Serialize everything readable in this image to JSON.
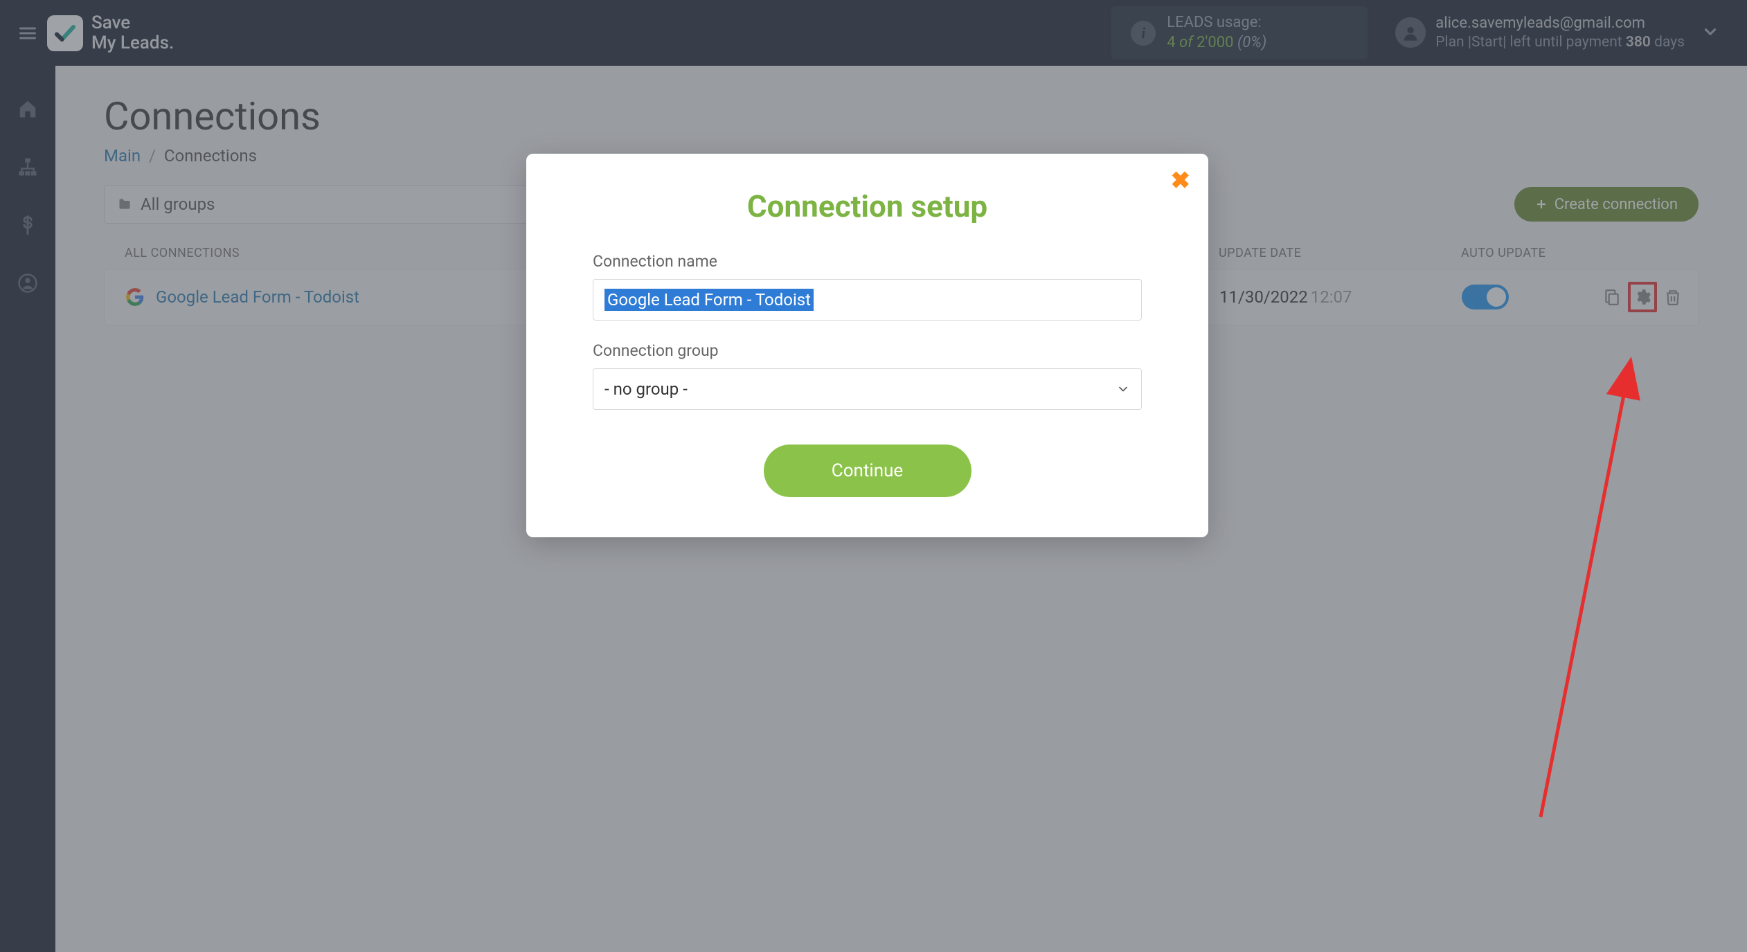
{
  "header": {
    "brand_line1": "Save",
    "brand_line2": "My Leads.",
    "leads_label": "LEADS usage:",
    "leads_current": "4",
    "leads_of": "of",
    "leads_total": "2'000",
    "leads_pct": "(0%)",
    "user_email": "alice.savemyleads@gmail.com",
    "user_plan_prefix": "Plan |Start| left until payment",
    "user_days": "380",
    "user_days_suffix": "days"
  },
  "page": {
    "title": "Connections",
    "breadcrumb_main": "Main",
    "breadcrumb_current": "Connections",
    "group_filter": "All groups",
    "create_label": "Create connection"
  },
  "table": {
    "headers": {
      "name": "ALL CONNECTIONS",
      "update": "UPDATE DATE",
      "auto": "AUTO UPDATE"
    },
    "rows": [
      {
        "name": "Google Lead Form - Todoist",
        "date": "11/30/2022",
        "time": "12:07",
        "auto_on": true
      }
    ]
  },
  "modal": {
    "title": "Connection setup",
    "name_label": "Connection name",
    "name_value": "Google Lead Form - Todoist",
    "group_label": "Connection group",
    "group_value": "- no group -",
    "continue": "Continue"
  }
}
